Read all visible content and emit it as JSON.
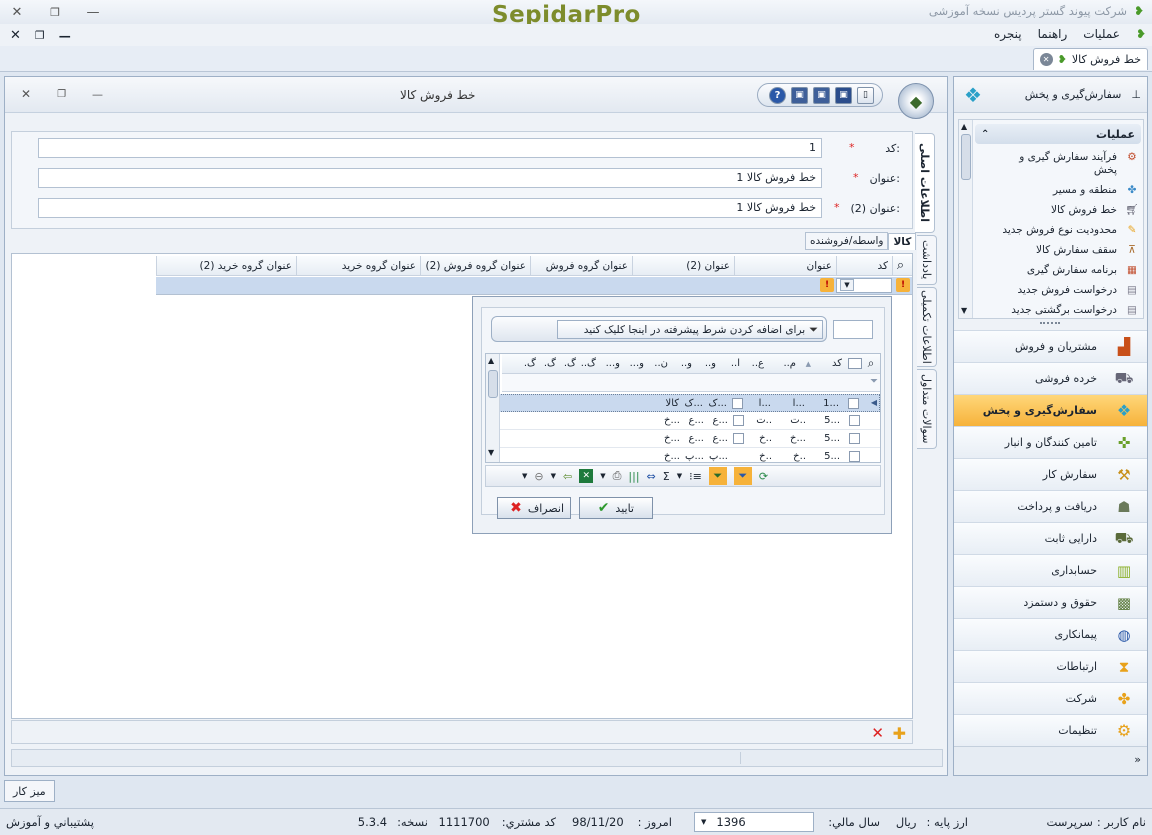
{
  "app": {
    "title": "شرکت پیوند گستر پردیس نسخه آموزشی",
    "logo_text": "SepidarPro"
  },
  "menu": {
    "items": [
      "عملیات",
      "راهنما",
      "پنجره"
    ]
  },
  "doc_tab": {
    "label": "خط فروش کالا"
  },
  "window": {
    "title": "خط فروش کالا",
    "form": {
      "code_label": "کد:",
      "code_value": "1",
      "title_label": "عنوان:",
      "title_value": "خط فروش کالا 1",
      "title2_label": "عنوان (2):",
      "title2_value": "خط فروش کالا 1",
      "required_mark": "*"
    },
    "side_tabs": [
      "اطلاعات اصلی",
      "یادداشت",
      "اطلاعات تکمیلی",
      "سوالات متداول"
    ],
    "sub_tabs": [
      "کالا",
      "واسطه/فروشنده"
    ],
    "grid_columns": [
      "کد",
      "عنوان",
      "عنوان (2)",
      "عنوان گروه فروش",
      "عنوان گروه فروش (2)",
      "عنوان گروه خرید",
      "عنوان گروه خرید (2)"
    ]
  },
  "popup": {
    "filter_hint": "برای اضافه کردن شرط پیشرفته در اینجا کلیک کنید",
    "columns": [
      "کد",
      "م..",
      "ع..",
      "ا..",
      "و..",
      "و..",
      "ن..",
      "و...",
      "و...",
      "گ..",
      "گ.",
      "گ.",
      "گ."
    ],
    "rows": [
      [
        "1...",
        "ا...",
        "ا...",
        "ک...",
        "ک...",
        "کالا"
      ],
      [
        "5...",
        "ت..",
        "ت..",
        "ع...",
        "ع...",
        "خ..."
      ],
      [
        "5...",
        "خ...",
        "خ..",
        "ع...",
        "ع...",
        "خ..."
      ],
      [
        "5...",
        "خ..",
        "خ..",
        "پ...",
        "پ...",
        "خ..."
      ]
    ],
    "ok_label": "تایید",
    "cancel_label": "انصراف"
  },
  "sidebar": {
    "header_title": "سفارش‌گیری و پخش",
    "section_title": "عملیات",
    "operations": [
      "فرآیند سفارش گیری و پخش",
      "منطقه و مسیر",
      "خط فروش کالا",
      "محدودیت نوع فروش جدید",
      "سقف سفارش کالا",
      "برنامه سفارش گیری",
      "درخواست فروش جدید",
      "درخواست برگشتی جدید"
    ],
    "nav_items": [
      "مشتریان و فروش",
      "خرده فروشی",
      "سفارش‌گیری و پخش",
      "تامین کنندگان و انبار",
      "سفارش کار",
      "دریافت و پرداخت",
      "دارایی ثابت",
      "حسابداری",
      "حقوق و دستمزد",
      "پیمانکاری",
      "ارتباطات",
      "شرکت",
      "تنظیمات"
    ],
    "active_nav": "سفارش‌گیری و پخش"
  },
  "desk_tab": {
    "label": "میز کار"
  },
  "status": {
    "user_label": "نام کاربر :",
    "user_value": "سرپرست",
    "currency_label": "ارز پایه :",
    "currency_value": "ریال",
    "fiscal_label": "سال مالي:",
    "fiscal_value": "1396",
    "today_label": "امروز :",
    "today_value": "98/11/20",
    "customer_label": "کد مشتري:",
    "customer_value": "1111700",
    "version_label": "نسخه:",
    "version_value": "5.3.4",
    "support_label": "پشتيباني و آموزش"
  },
  "colors": {
    "accent_orange": "#f6b23a",
    "frame": "#9eb0c6",
    "selected_row": "#c9d9ee"
  }
}
